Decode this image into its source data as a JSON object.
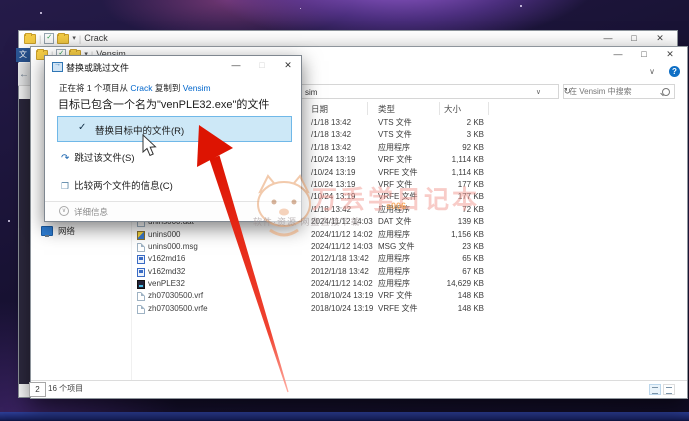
{
  "back_window": {
    "title": "Crack",
    "file_menu_label": "文",
    "status_fragment": "2"
  },
  "window": {
    "title": "Vensim",
    "address_visible_text": "sim",
    "search_placeholder": "在 Vensim 中搜索",
    "status_items": "16 个项目",
    "sidebar": {
      "network_label": "网络"
    }
  },
  "files": {
    "columns": {
      "date": "日期",
      "type": "类型",
      "size": "大小"
    },
    "rows": [
      {
        "name": "",
        "icon": "",
        "date": "/1/18 13:42",
        "type": "VTS 文件",
        "size": "2 KB"
      },
      {
        "name": "",
        "icon": "",
        "date": "/1/18 13:42",
        "type": "VTS 文件",
        "size": "3 KB"
      },
      {
        "name": "",
        "icon": "",
        "date": "/1/18 13:42",
        "type": "应用程序",
        "size": "92 KB"
      },
      {
        "name": "",
        "icon": "",
        "date": "/10/24 13:19",
        "type": "VRF 文件",
        "size": "1,114 KB"
      },
      {
        "name": "",
        "icon": "",
        "date": "/10/24 13:19",
        "type": "VRFE 文件",
        "size": "1,114 KB"
      },
      {
        "name": "",
        "icon": "",
        "date": "/10/24 13:19",
        "type": "VRF 文件",
        "size": "177 KB"
      },
      {
        "name": "",
        "icon": "",
        "date": "/10/24 13:19",
        "type": "VRFE 文件",
        "size": "177 KB"
      },
      {
        "name": "",
        "icon": "",
        "date": "/1/18 13:42",
        "type": "应用程序",
        "size": "72 KB"
      },
      {
        "name": "unins000.dat",
        "icon": "page",
        "date": "2024/11/12 14:03",
        "type": "DAT 文件",
        "size": "139 KB"
      },
      {
        "name": "unins000",
        "icon": "app-installer",
        "date": "2024/11/12 14:02",
        "type": "应用程序",
        "size": "1,156 KB"
      },
      {
        "name": "unins000.msg",
        "icon": "page",
        "date": "2024/11/12 14:03",
        "type": "MSG 文件",
        "size": "23 KB"
      },
      {
        "name": "v162md16",
        "icon": "app-blue",
        "date": "2012/1/18 13:42",
        "type": "应用程序",
        "size": "65 KB"
      },
      {
        "name": "v162md32",
        "icon": "app-blue",
        "date": "2012/1/18 13:42",
        "type": "应用程序",
        "size": "67 KB"
      },
      {
        "name": "venPLE32",
        "icon": "app-dark",
        "date": "2024/11/12 14:02",
        "type": "应用程序",
        "size": "14,629 KB"
      },
      {
        "name": "zh07030500.vrf",
        "icon": "page",
        "date": "2018/10/24 13:19",
        "type": "VRF 文件",
        "size": "148 KB"
      },
      {
        "name": "zh07030500.vrfe",
        "icon": "page",
        "date": "2018/10/24 13:19",
        "type": "VRFE 文件",
        "size": "148 KB"
      }
    ]
  },
  "dialog": {
    "title": "替换或跳过文件",
    "copy_line": {
      "prefix": "正在将 1 个项目从 ",
      "source": "Crack",
      "middle": " 复制到 ",
      "dest": "Vensim"
    },
    "conflict_line": "目标已包含一个名为\"venPLE32.exe\"的文件",
    "options": [
      {
        "label": "替换目标中的文件(R)"
      },
      {
        "label": "跳过该文件(S)"
      },
      {
        "label": "比较两个文件的信息(C)"
      }
    ],
    "details_label": "详细信息"
  },
  "watermark": {
    "line_big": "万丢学日记本",
    "line_code": "s006",
    "line_small": "软件·资源 网盘直接下载"
  },
  "icons": {
    "minimize": "—",
    "maximize": "□",
    "close": "✕",
    "caret_down": "▾",
    "chevron_down": "∨",
    "help": "?",
    "refresh": "↻",
    "back": "←",
    "check": "✓",
    "skip": "↷",
    "compare": "❐",
    "separator": "|"
  },
  "colors": {
    "accent_blue": "#0066cc",
    "selection_bg": "#cde8f7",
    "selection_border": "#70b8e8",
    "arrow_red": "#e01703"
  }
}
